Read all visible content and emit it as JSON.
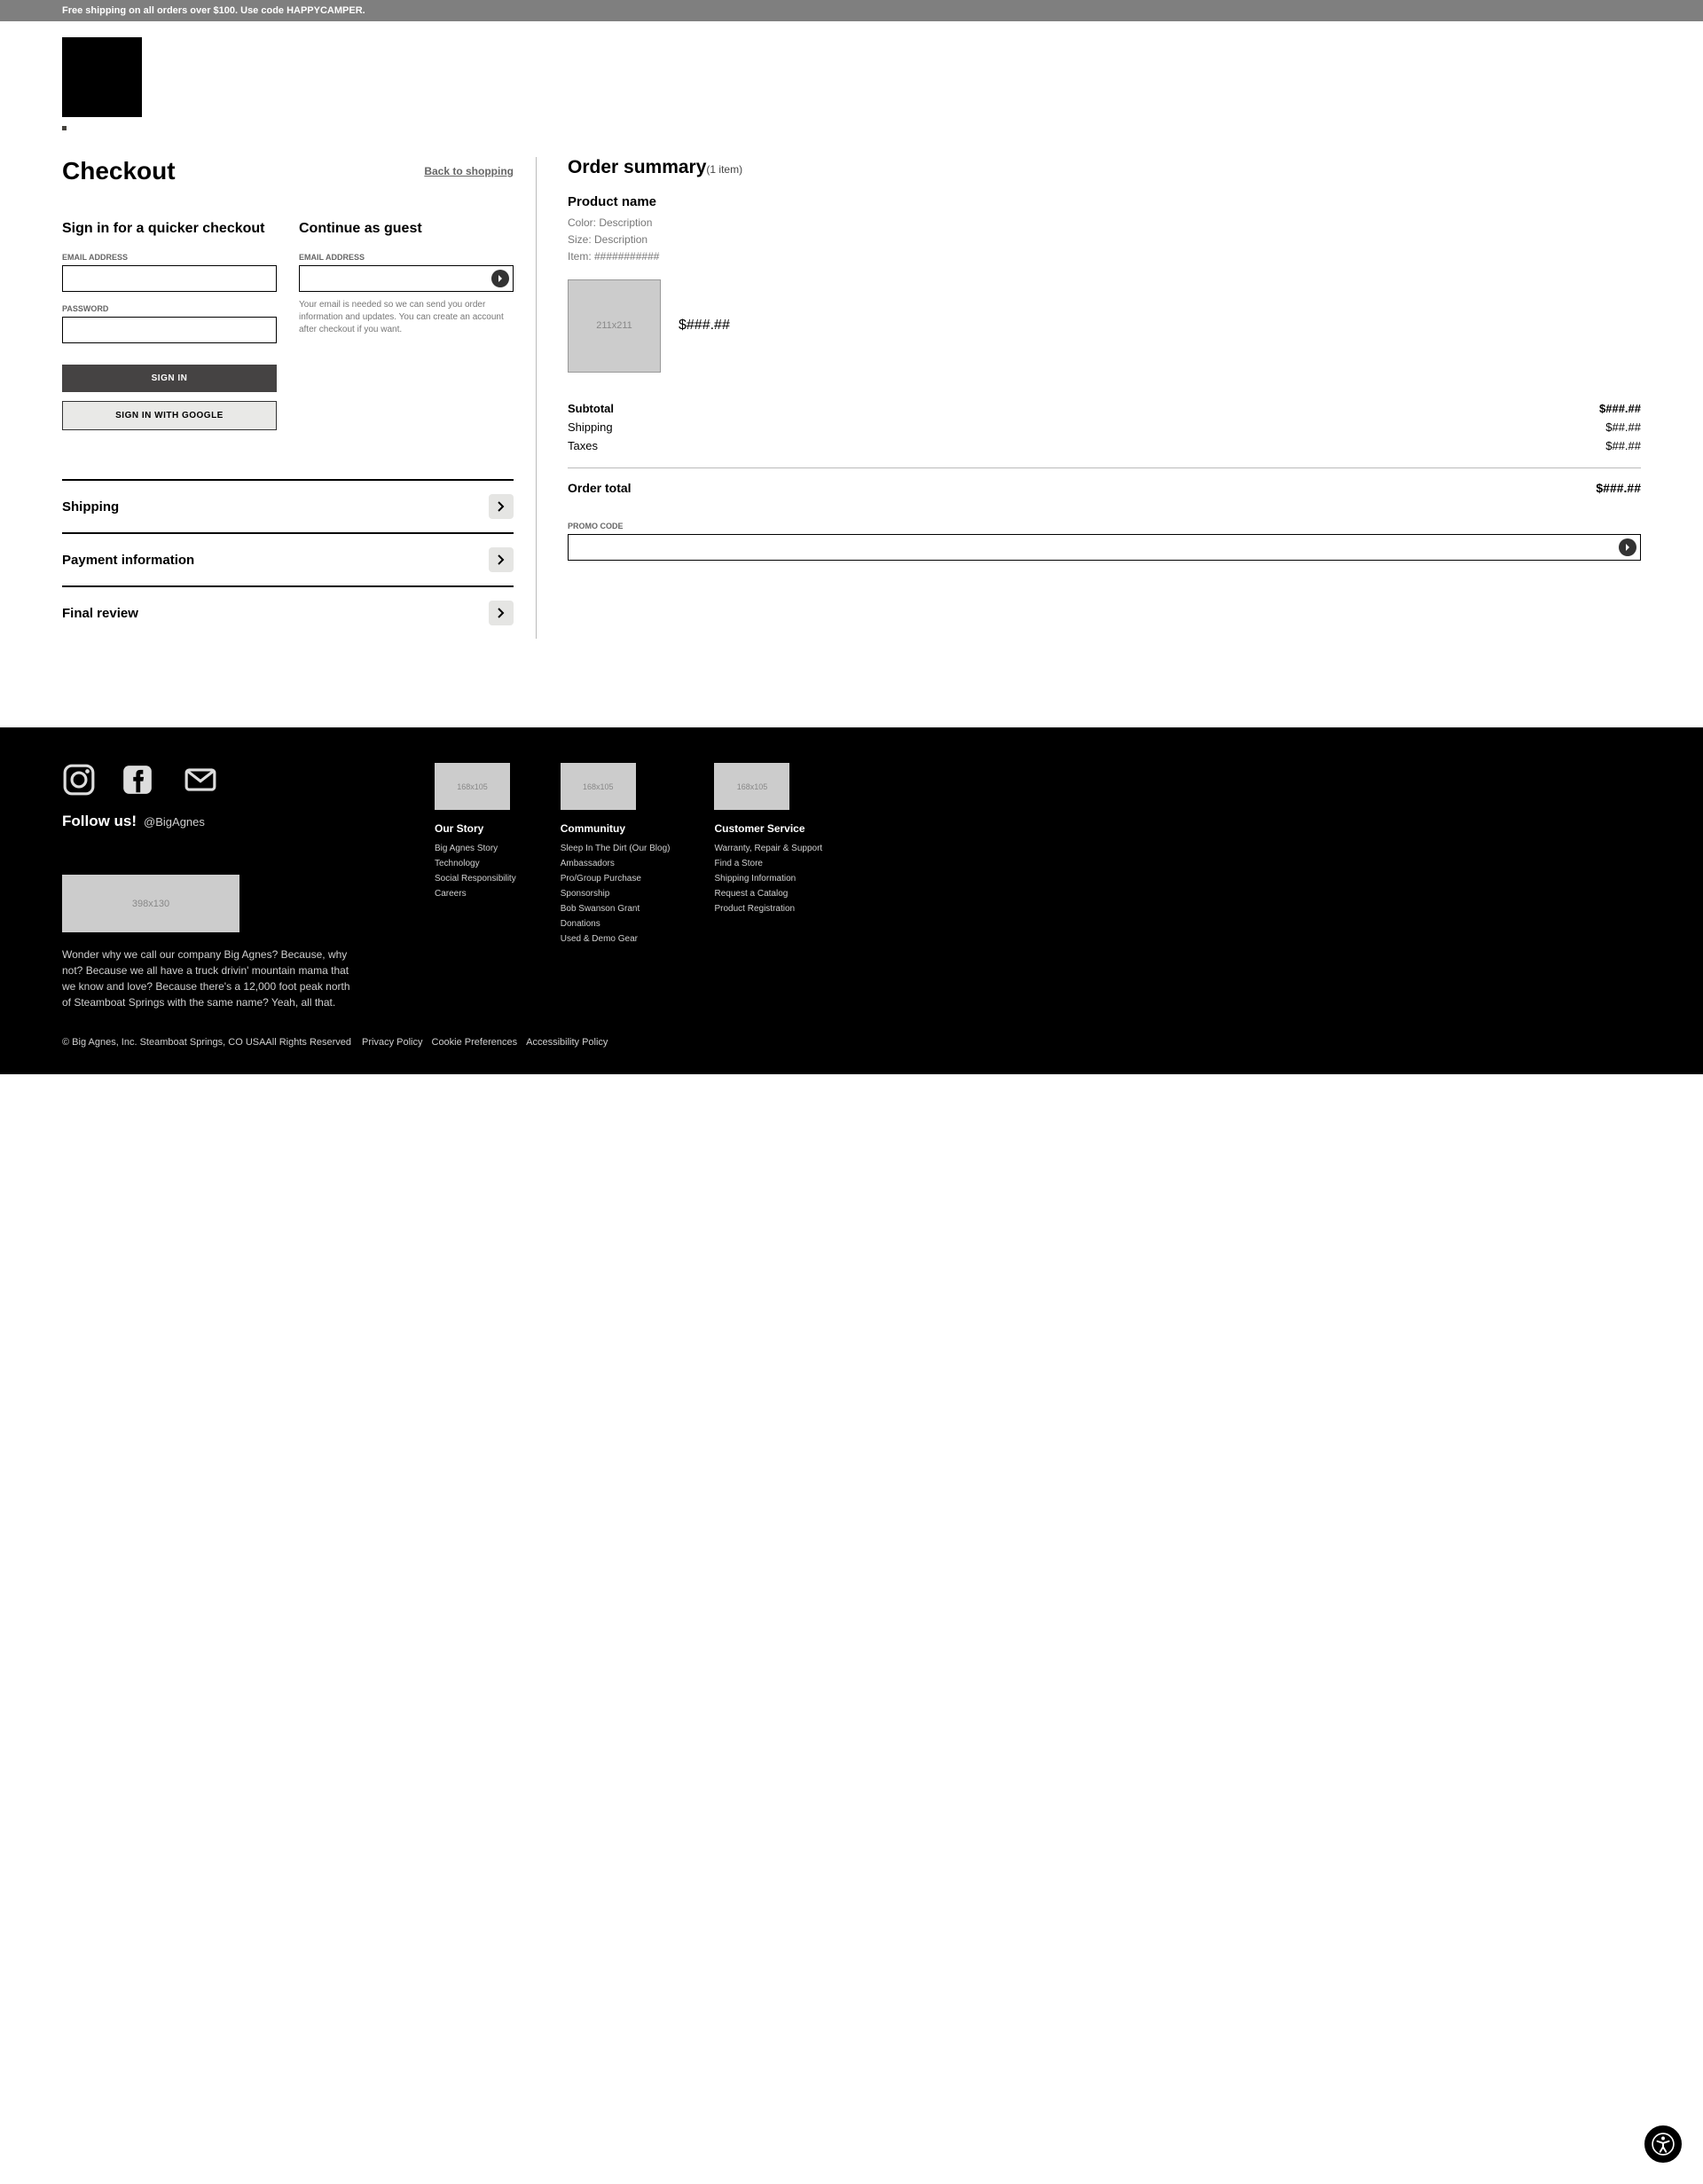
{
  "promo_bar": "Free shipping on all orders over $100.  Use code HAPPYCAMPER.",
  "checkout": {
    "title": "Checkout",
    "back_link": "Back to shopping",
    "signin": {
      "heading": "Sign in for a quicker checkout",
      "email_label": "EMAIL ADDRESS",
      "password_label": "PASSWORD",
      "signin_btn": "SIGN IN",
      "google_btn": "SIGN IN WITH GOOGLE"
    },
    "guest": {
      "heading": "Continue as guest",
      "email_label": "EMAIL ADDRESS",
      "helper": "Your email is needed so we can send you order information and updates. You can create an account after checkout if you want."
    },
    "sections": {
      "shipping": "Shipping",
      "payment": "Payment information",
      "review": "Final review"
    }
  },
  "summary": {
    "title": "Order summary",
    "count_text": "(1 item)",
    "product": {
      "name": "Product name",
      "color_line": "Color: Description",
      "size_line": "Size: Description",
      "item_line": "Item: ###########",
      "img_placeholder": "211x211",
      "price": "$###.##"
    },
    "subtotal_label": "Subtotal",
    "subtotal_value": "$###.##",
    "shipping_label": "Shipping",
    "shipping_value": "$##.##",
    "taxes_label": "Taxes",
    "taxes_value": "$##.##",
    "order_total_label": "Order total",
    "order_total_value": "$###.##",
    "promo_label": "PROMO CODE"
  },
  "footer": {
    "follow_title": "Follow us!",
    "follow_handle": "@BigAgnes",
    "brand_img_placeholder": "398x130",
    "desc": "Wonder why we call our company Big Agnes? Because, why not? Because we all have a truck drivin' mountain mama that we know and love? Because there's a 12,000 foot peak north of Steamboat Springs with the same name? Yeah, all that.",
    "cols": [
      {
        "img": "168x105",
        "heading": "Our Story",
        "links": [
          "Big Agnes Story",
          "Technology",
          "Social Responsibility",
          "Careers"
        ]
      },
      {
        "img": "168x105",
        "heading": "Communituy",
        "links": [
          "Sleep In The Dirt (Our Blog)",
          "Ambassadors",
          "Pro/Group Purchase",
          "Sponsorship",
          "Bob Swanson Grant",
          "Donations",
          "Used & Demo Gear"
        ]
      },
      {
        "img": "168x105",
        "heading": "Customer Service",
        "links": [
          "Warranty, Repair & Support",
          "Find a Store",
          "Shipping Information",
          "Request a Catalog",
          "Product Registration"
        ]
      }
    ],
    "copyright": "© Big Agnes, Inc. Steamboat Springs, CO USAAll Rights Reserved",
    "bottom_links": [
      "Privacy Policy",
      "Cookie Preferences",
      "Accessibility Policy"
    ]
  }
}
